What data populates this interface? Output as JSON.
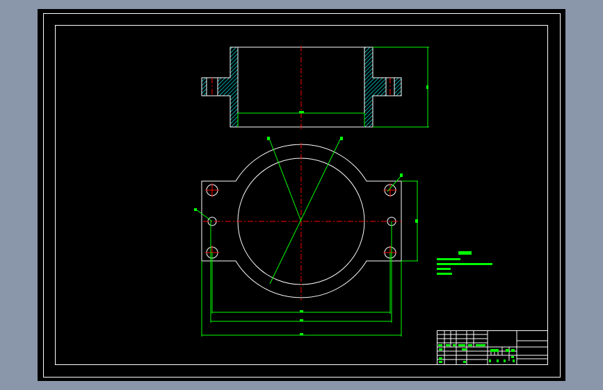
{
  "viewer": {
    "background_color": "#8a97aa",
    "canvas_color": "#000000"
  },
  "drawing": {
    "colors": {
      "outline": "#ffffff",
      "dimension": "#00ff00",
      "centerline": "#ff0000",
      "hatch": "#00ffff"
    }
  }
}
